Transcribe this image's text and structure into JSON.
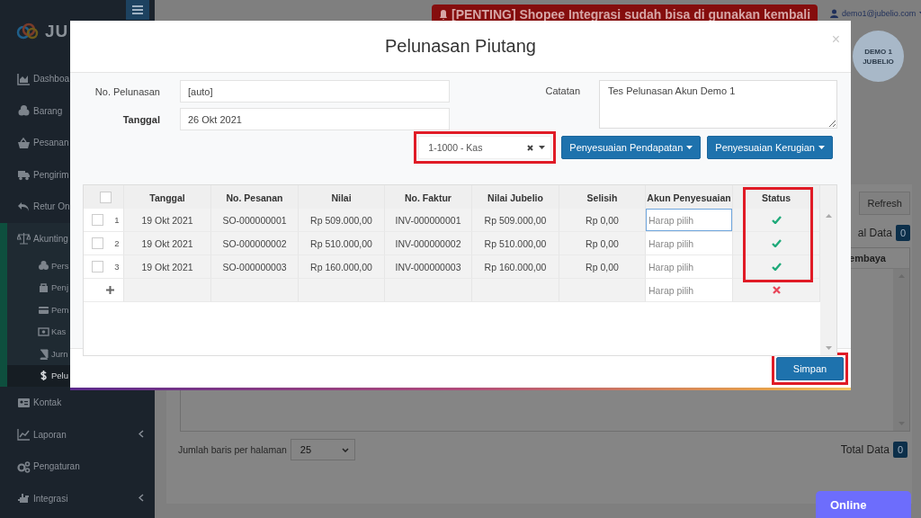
{
  "sidebar": {
    "logo": "JU",
    "items": [
      {
        "label": "Dashboa",
        "kind": "link",
        "selected": false
      },
      {
        "label": "Barang",
        "kind": "link",
        "selected": false
      },
      {
        "label": "Pesanan",
        "kind": "link",
        "selected": false
      },
      {
        "label": "Pengirim",
        "kind": "link",
        "selected": false
      },
      {
        "label": "Retur On",
        "kind": "link",
        "selected": false
      },
      {
        "label": "Akunting",
        "kind": "menu",
        "expanded": true,
        "selected": false,
        "children": [
          {
            "label": "Pers",
            "selected": false
          },
          {
            "label": "Penj",
            "selected": false
          },
          {
            "label": "Pem",
            "selected": false
          },
          {
            "label": "Kas",
            "selected": false
          },
          {
            "label": "Jurn",
            "selected": false
          },
          {
            "label": "Pelu",
            "selected": true
          }
        ]
      },
      {
        "label": "Kontak",
        "kind": "link",
        "selected": false
      },
      {
        "label": "Laporan",
        "kind": "menu",
        "expanded": false,
        "selected": false
      },
      {
        "label": "Pengaturan",
        "kind": "link",
        "selected": false
      },
      {
        "label": "Integrasi",
        "kind": "menu",
        "expanded": false,
        "selected": false
      }
    ]
  },
  "topbar": {
    "banner": "[PENTING] Shopee Integrasi sudah bisa di gunakan kembali",
    "user": "demo1@jubelio.com",
    "avatar_lines": [
      "DEMO 1",
      "JUBELIO"
    ]
  },
  "page": {
    "refresh_button": "Refresh",
    "total_top": {
      "label": "al Data",
      "count": "0"
    },
    "column_head": "embaya",
    "rows_per_page": {
      "label": "Jumlah baris per halaman",
      "value": "25"
    },
    "total_bottom": {
      "label": "Total Data",
      "count": "0"
    }
  },
  "chat_button": "Online",
  "modal": {
    "title": "Pelunasan Piutang",
    "close": "×",
    "fields": {
      "no_pelunasan": {
        "label": "No. Pelunasan",
        "value": "[auto]"
      },
      "tanggal": {
        "label": "Tanggal",
        "value": "26 Okt 2021"
      },
      "catatan": {
        "label": "Catatan",
        "value": "Tes Pelunasan Akun Demo 1"
      }
    },
    "account_select": {
      "value": "1-1000 - Kas",
      "highlighted": true
    },
    "dropdown_buttons": [
      "Penyesuaian Pendapatan",
      "Penyesuaian Kerugian"
    ],
    "table": {
      "header_checked": false,
      "status_highlighted": true,
      "columns": [
        "Tanggal",
        "No. Pesanan",
        "Nilai",
        "No. Faktur",
        "Nilai Jubelio",
        "Selisih",
        "Akun Penyesuaian",
        "Status"
      ],
      "rows": [
        {
          "number": "1",
          "checked": false,
          "cells": [
            "19 Okt 2021",
            "SO-000000001",
            "Rp 509.000,00",
            "INV-000000001",
            "Rp 509.000,00",
            "Rp 0,00"
          ],
          "account_placeholder": "Harap pilih",
          "focused": true,
          "valid": true
        },
        {
          "number": "2",
          "checked": false,
          "cells": [
            "19 Okt 2021",
            "SO-000000002",
            "Rp 510.000,00",
            "INV-000000002",
            "Rp 510.000,00",
            "Rp 0,00"
          ],
          "account_placeholder": "Harap pilih",
          "focused": false,
          "valid": true
        },
        {
          "number": "3",
          "checked": false,
          "cells": [
            "19 Okt 2021",
            "SO-000000003",
            "Rp 160.000,00",
            "INV-000000003",
            "Rp 160.000,00",
            "Rp 0,00"
          ],
          "account_placeholder": "Harap pilih",
          "focused": false,
          "valid": true
        }
      ],
      "new_row": {
        "account_placeholder": "Harap pilih",
        "valid": false
      }
    },
    "save_button": {
      "label": "Simpan",
      "highlighted": true
    }
  }
}
